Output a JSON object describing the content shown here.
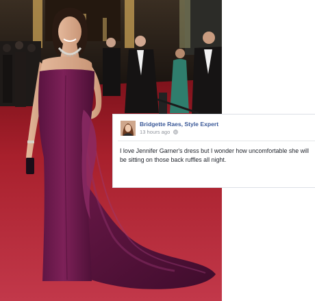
{
  "post": {
    "author": "Bridgette Raes, Style Expert",
    "timestamp": "13 hours ago",
    "text": "I love Jennifer Garner's dress but I wonder how uncomfortable she will be sitting on those back ruffles all night."
  },
  "colors": {
    "link_blue": "#3b5998",
    "meta_gray": "#90949c",
    "carpet_red": "#b31d2a",
    "dress_plum": "#6e1a4b"
  },
  "icons": {
    "author_avatar": "avatar",
    "privacy": "globe-icon"
  }
}
